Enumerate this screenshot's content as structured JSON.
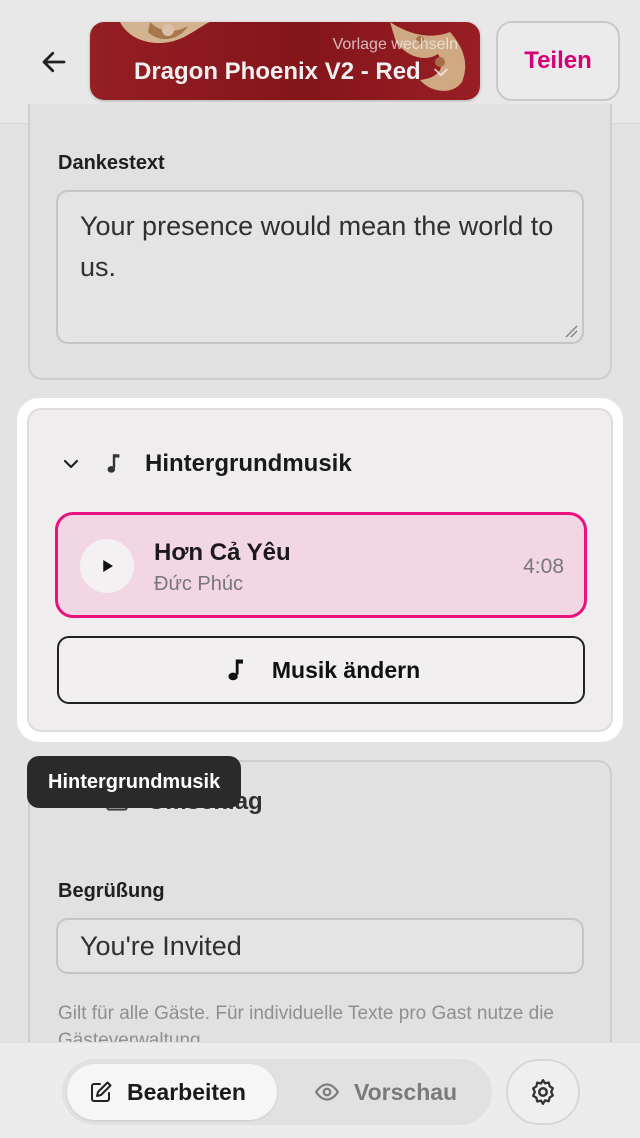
{
  "header": {
    "template_switch_label": "Vorlage wechseln",
    "template_name": "Dragon Phoenix V2 - Red",
    "share_label": "Teilen"
  },
  "thanks": {
    "label": "Dankestext",
    "value": "Your presence would mean the world to us."
  },
  "music": {
    "section_title": "Hintergrundmusik",
    "track": {
      "title": "Hơn Cả Yêu",
      "artist": "Đức Phúc",
      "duration": "4:08"
    },
    "change_label": "Musik ändern"
  },
  "tooltip": "Hintergrundmusik",
  "cover": {
    "section_title": "Umschlag",
    "greeting_label": "Begrüßung",
    "greeting_value": "You're Invited",
    "hint": "Gilt für alle Gäste. Für individuelle Texte pro Gast nutze die Gästeverwaltung."
  },
  "bottom": {
    "edit_label": "Bearbeiten",
    "preview_label": "Vorschau"
  },
  "colors": {
    "accent": "#e6007e",
    "template_red": "#9e2128"
  },
  "icons": [
    "arrow-left-icon",
    "chevron-down-icon",
    "music-note-icon",
    "play-icon",
    "envelope-icon",
    "pencil-square-icon",
    "eye-icon",
    "gear-icon"
  ]
}
